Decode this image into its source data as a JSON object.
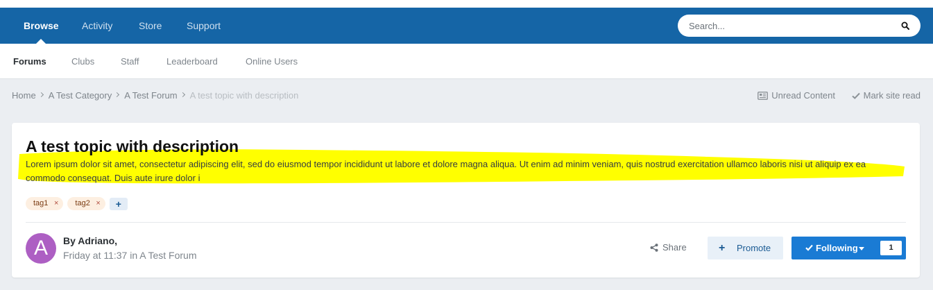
{
  "nav": {
    "items": [
      "Browse",
      "Activity",
      "Store",
      "Support"
    ],
    "active": "Browse",
    "search_placeholder": "Search..."
  },
  "subnav": {
    "items": [
      "Forums",
      "Clubs",
      "Staff",
      "Leaderboard",
      "Online Users"
    ],
    "active": "Forums"
  },
  "breadcrumb": {
    "items": [
      "Home",
      "A Test Category",
      "A Test Forum"
    ],
    "current": "A test topic with description"
  },
  "actions": {
    "unread": "Unread Content",
    "mark_read": "Mark site read"
  },
  "topic": {
    "title": "A test topic with description",
    "description": "Lorem ipsum dolor sit amet, consectetur adipiscing elit, sed do eiusmod tempor incididunt ut labore et dolore magna aliqua. Ut enim ad minim veniam, quis nostrud exercitation ullamco laboris nisi ut aliquip ex ea commodo consequat. Duis aute irure dolor i",
    "tags": [
      "tag1",
      "tag2"
    ],
    "tag_remove": "×",
    "tag_add": "+",
    "author_initial": "A",
    "author_line": "By Adriano,",
    "time": "Friday at 11:37",
    "in_word": "in",
    "forum": "A Test Forum"
  },
  "buttons": {
    "share": "Share",
    "promote_icon": "+",
    "promote": "Promote",
    "following": "Following",
    "following_count": "1"
  },
  "colors": {
    "navbar": "#1565a6",
    "highlight": "#ffff00",
    "follow_button": "#1a7bd4",
    "avatar": "#ad5fc3",
    "tag_bg": "#fdefe1"
  }
}
